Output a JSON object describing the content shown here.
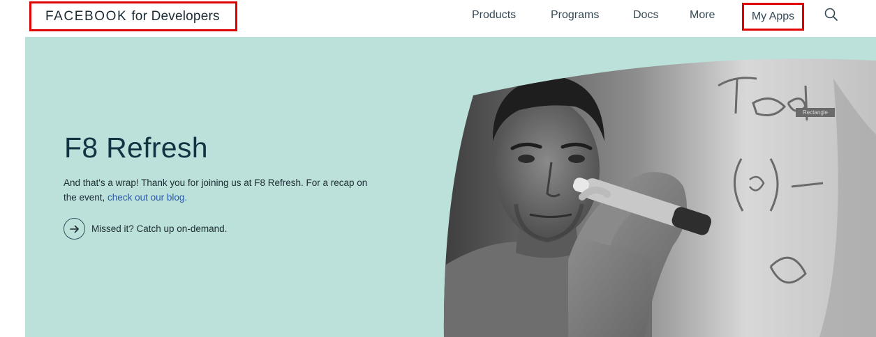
{
  "header": {
    "brand_strong": "FACEBOOK",
    "brand_rest": "for Developers",
    "nav": {
      "products": "Products",
      "programs": "Programs",
      "docs": "Docs",
      "more": "More",
      "my_apps": "My Apps"
    },
    "search_icon": "search-icon"
  },
  "hero": {
    "title": "F8 Refresh",
    "body_text": "And that's a wrap! Thank you for joining us at F8 Refresh. For a recap on the event, ",
    "body_link": "check out our blog.",
    "cta_icon": "arrow-right-icon",
    "cta_label": "Missed it? Catch up on-demand.",
    "photo_badge": "Rectangle"
  },
  "colors": {
    "hero_bg": "#bce0da",
    "highlight_border": "#e00000",
    "link": "#2a5aa8",
    "title": "#123341"
  }
}
